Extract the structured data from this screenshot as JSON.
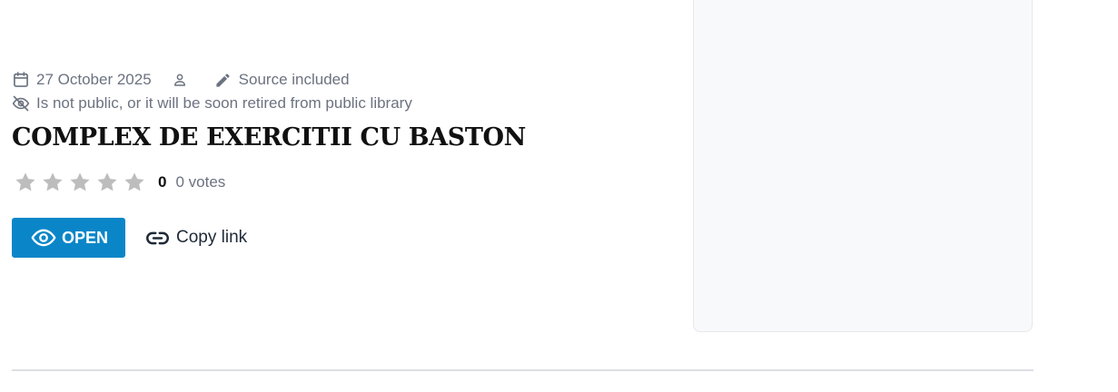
{
  "meta": {
    "date": "27 October 2025",
    "author": "",
    "source": "Source included",
    "visibility_notice": "Is not public, or it will be soon retired from public library"
  },
  "document": {
    "title": "COMPLEX DE EXERCITII CU BASTON"
  },
  "rating": {
    "max_stars": 5,
    "filled_stars": 0,
    "value": "0",
    "votes": "0 votes"
  },
  "actions": {
    "open_label": "OPEN",
    "copy_link_label": "Copy link"
  },
  "icons": {
    "date": "calendar-icon",
    "author": "user-icon",
    "source": "pencil-icon",
    "visibility": "eye-off-icon",
    "open": "eye-icon",
    "copy": "link-icon",
    "star": "star-icon"
  },
  "colors": {
    "primary": "#0a86c8",
    "muted_text": "#6b7280",
    "star_empty": "#bdbdbd",
    "card_bg": "#f8f9fb"
  }
}
